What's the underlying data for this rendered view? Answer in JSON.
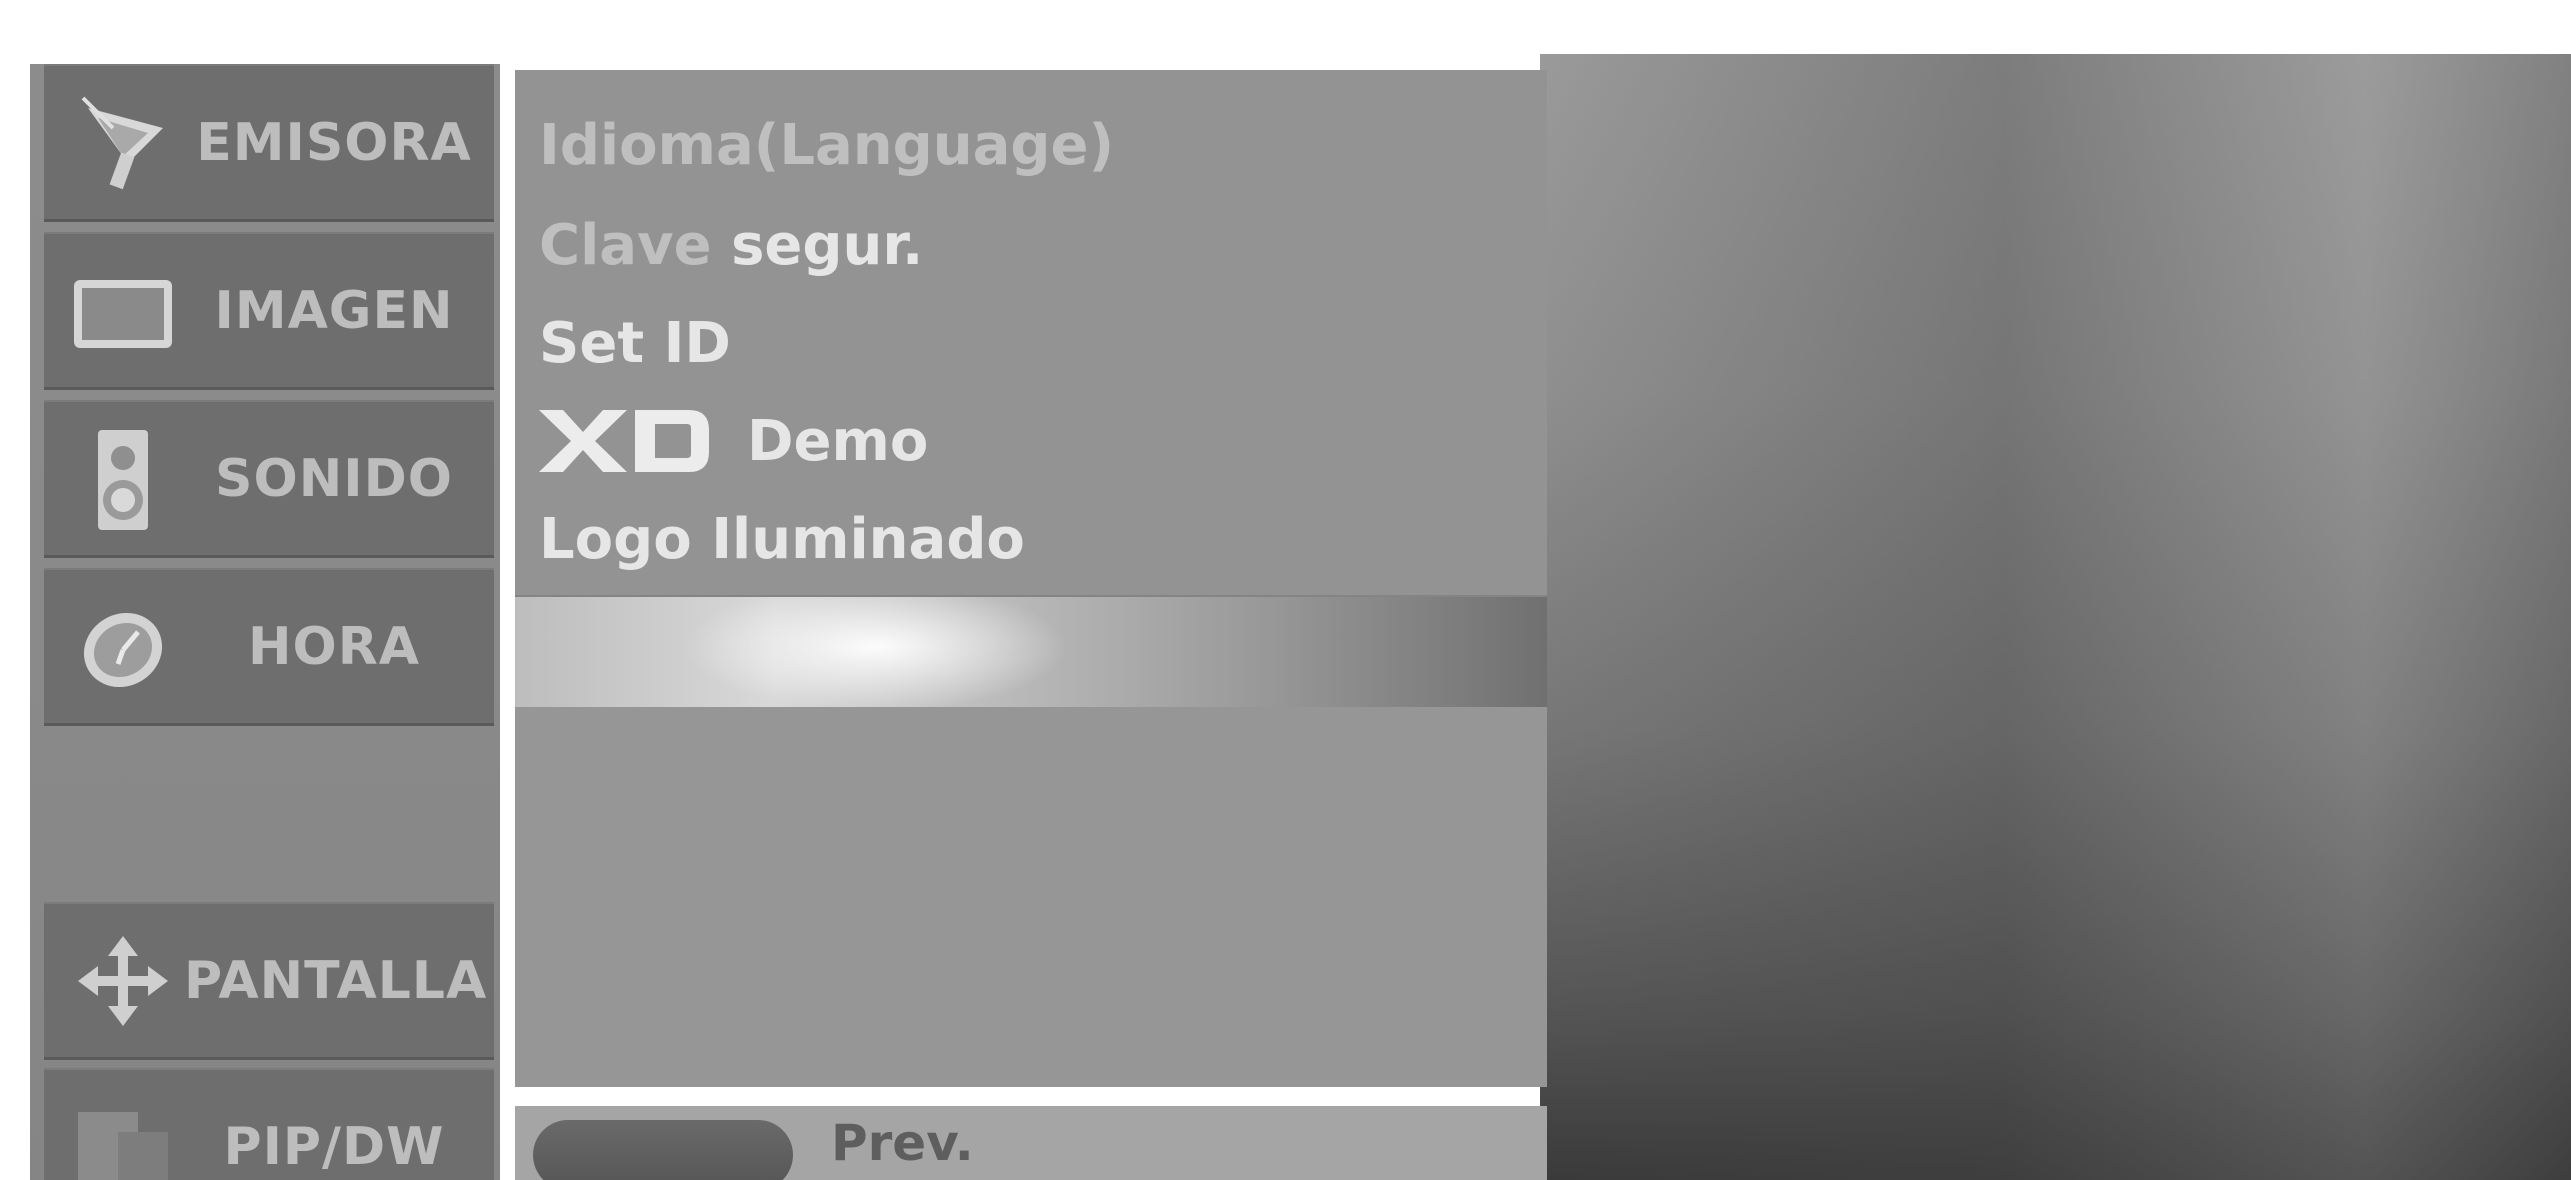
{
  "sidebar": {
    "items": [
      {
        "label": "EMISORA",
        "icon": "satellite-dish-icon"
      },
      {
        "label": "IMAGEN",
        "icon": "screen-icon"
      },
      {
        "label": "SONIDO",
        "icon": "speaker-icon"
      },
      {
        "label": "HORA",
        "icon": "clock-icon"
      },
      {
        "label": "PANTALLA",
        "icon": "move-arrows-icon"
      },
      {
        "label": "PIP/DW",
        "icon": "pip-icon"
      }
    ]
  },
  "menu": {
    "items": [
      {
        "label": "Idioma(Language)"
      },
      {
        "label_part1": "Clave",
        "label_part2": "segur."
      },
      {
        "label": "Set ID"
      },
      {
        "logo": "XD",
        "label": "Demo"
      },
      {
        "label_part1": "Logo",
        "label_part2": "Iluminado"
      }
    ]
  },
  "bottom_bar": {
    "prev_label": "Prev."
  },
  "colors": {
    "panel": "#939393",
    "sidebar_item": "#6e6e6e",
    "label": "#bdbdbd",
    "highlight_text": "#e6e6e6"
  }
}
